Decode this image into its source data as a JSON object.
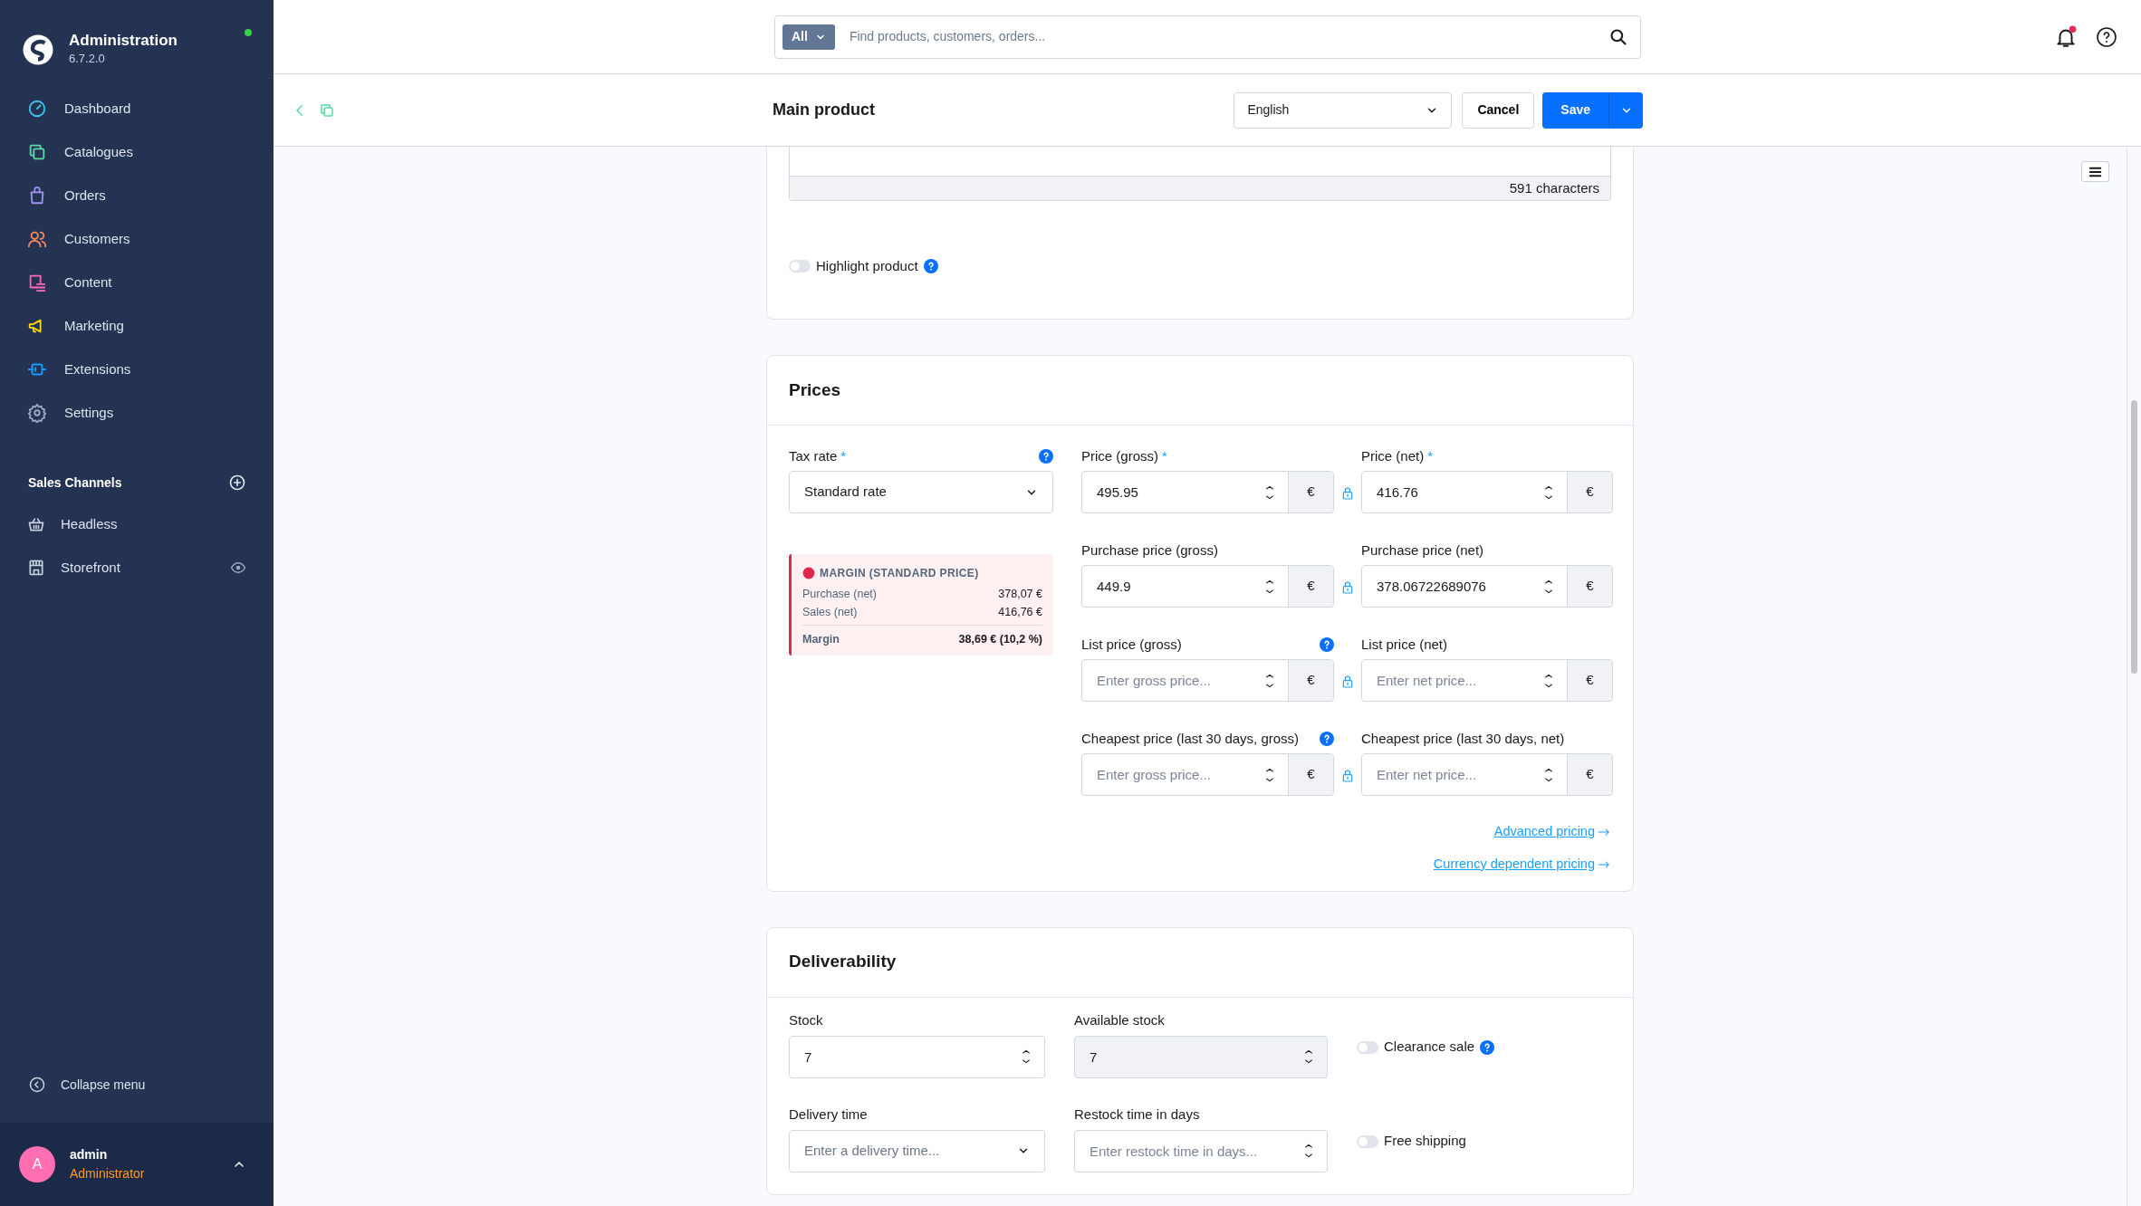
{
  "sidebar": {
    "title": "Administration",
    "version": "6.7.2.0",
    "online": true,
    "items": [
      {
        "kind": "dashboard",
        "label": "Dashboard",
        "color": "#40c4e8"
      },
      {
        "kind": "catalogues",
        "label": "Catalogues",
        "color": "#57d9a3"
      },
      {
        "kind": "orders",
        "label": "Orders",
        "color": "#a092f0"
      },
      {
        "kind": "customers",
        "label": "Customers",
        "color": "#f88962"
      },
      {
        "kind": "content",
        "label": "Content",
        "color": "#ff68b4"
      },
      {
        "kind": "marketing",
        "label": "Marketing",
        "color": "#ffd700"
      },
      {
        "kind": "extensions",
        "label": "Extensions",
        "color": "#189eff"
      },
      {
        "kind": "settings",
        "label": "Settings",
        "color": "#9aa8c0"
      }
    ],
    "sales_channels": {
      "title": "Sales Channels",
      "items": [
        {
          "kind": "headless",
          "label": "Headless"
        },
        {
          "kind": "storefront",
          "label": "Storefront"
        }
      ]
    },
    "collapse": "Collapse menu",
    "user": {
      "initial": "A",
      "name": "admin",
      "role": "Administrator"
    }
  },
  "search": {
    "scope": "All",
    "placeholder": "Find products, customers, orders..."
  },
  "notifications": {
    "unread": true
  },
  "header": {
    "title": "Main product",
    "language": "English",
    "cancel": "Cancel",
    "save": "Save"
  },
  "description_card": {
    "counter": "591 characters",
    "toggles": [
      {
        "label": "Highlight product",
        "on": false,
        "help": true
      }
    ]
  },
  "prices": {
    "title": "Prices",
    "tax_rate": {
      "label": "Tax rate",
      "required_mark": "*",
      "help": true,
      "value": "Standard rate"
    },
    "margin": {
      "title": "MARGIN (STANDARD PRICE)",
      "rows": [
        {
          "label": "Purchase (net)",
          "value": "378,07 €"
        },
        {
          "label": "Sales (net)",
          "value": "416,76 €"
        }
      ],
      "total": {
        "label": "Margin",
        "value": "38,69 € (10,2 %)"
      }
    },
    "price_rows": [
      {
        "gross": {
          "label": "Price (gross)",
          "required_mark": "*",
          "help": false,
          "value": "495.95",
          "currency": "€"
        },
        "net": {
          "label": "Price (net)",
          "required_mark": "*",
          "value": "416.76",
          "currency": "€"
        }
      },
      {
        "gross": {
          "label": "Purchase price (gross)",
          "help": false,
          "value": "449.9",
          "currency": "€"
        },
        "net": {
          "label": "Purchase price (net)",
          "value": "378.06722689076",
          "currency": "€"
        }
      },
      {
        "gross": {
          "label": "List price (gross)",
          "help": true,
          "placeholder": "Enter gross price...",
          "currency": "€"
        },
        "net": {
          "label": "List price (net)",
          "placeholder": "Enter net price...",
          "currency": "€"
        }
      },
      {
        "gross": {
          "label": "Cheapest price (last 30 days, gross)",
          "help": true,
          "placeholder": "Enter gross price...",
          "currency": "€"
        },
        "net": {
          "label": "Cheapest price (last 30 days, net)",
          "placeholder": "Enter net price...",
          "currency": "€"
        }
      }
    ],
    "links": [
      "Advanced pricing",
      "Currency dependent pricing"
    ]
  },
  "deliverability": {
    "title": "Deliverability",
    "fields": [
      {
        "label": "Stock",
        "kind": "number",
        "value": "7",
        "disabled": false
      },
      {
        "label": "Available stock",
        "kind": "number",
        "value": "7",
        "disabled": true
      },
      {
        "label": "Delivery time",
        "kind": "select",
        "placeholder": "Enter a delivery time..."
      },
      {
        "label": "Restock time in days",
        "kind": "number",
        "placeholder": "Enter restock time in days...",
        "disabled": false
      }
    ],
    "toggles": [
      {
        "label": "Clearance sale",
        "on": false,
        "help": true
      },
      {
        "label": "Free shipping",
        "on": false,
        "help": false
      }
    ]
  }
}
